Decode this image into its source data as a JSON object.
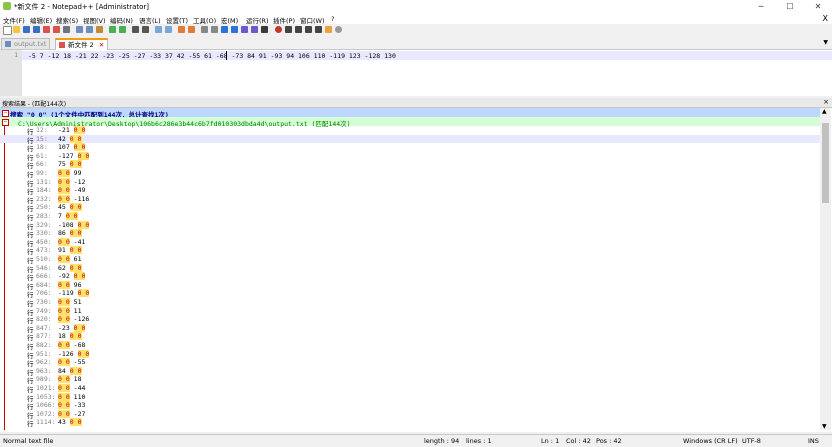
{
  "window": {
    "title": "*新文件 2 - Notepad++ [Administrator]",
    "minimize": "─",
    "maximize": "☐",
    "close": "✕"
  },
  "menu": {
    "items": [
      "文件(F)",
      "编辑(E)",
      "搜索(S)",
      "视图(V)",
      "编码(N)",
      "语言(L)",
      "设置(T)",
      "工具(O)",
      "宏(M)",
      "运行(R)",
      "插件(P)",
      "窗口(W)",
      "?"
    ],
    "close": "X"
  },
  "tabs": [
    {
      "label": "output.txt",
      "active": false
    },
    {
      "label": "新文件 2",
      "active": true
    }
  ],
  "tab_close": "✕",
  "tab_dropdown": "▼",
  "editor": {
    "line_number": "1",
    "text": "-5 7 -12 18 -21 22 -23 -25 -27 -33 37 42 -55 61 -68 -73 84 91 -93 94 106 110 -119 123 -128 130"
  },
  "find_panel": {
    "title": "搜索结果 - (匹配144次)",
    "close": "×",
    "search_line": "搜索 \"0 0\" (1个文件中匹配到144次，总计查找1次)",
    "file_line": "C:\\Users\\Administrator\\Desktop\\106b6c286e3b44c6b7fd010303dbda4d\\output.txt (匹配144次)",
    "row_prefix": "行",
    "rows": [
      {
        "line": "12",
        "before": "-21 ",
        "match": "0 0",
        "after": ""
      },
      {
        "line": "15",
        "before": "42 ",
        "match": "0 0",
        "after": ""
      },
      {
        "line": "18",
        "before": "107 ",
        "match": "0 0",
        "after": ""
      },
      {
        "line": "61",
        "before": "-127 ",
        "match": "0 0",
        "after": ""
      },
      {
        "line": "66",
        "before": "75 ",
        "match": "0 0",
        "after": ""
      },
      {
        "line": "99",
        "before": "",
        "match": "0 0",
        "after": " 99"
      },
      {
        "line": "131",
        "before": "",
        "match": "0 0",
        "after": " -12"
      },
      {
        "line": "184",
        "before": "",
        "match": "0 0",
        "after": " -49"
      },
      {
        "line": "232",
        "before": "",
        "match": "0 0",
        "after": " -116"
      },
      {
        "line": "250",
        "before": "45 ",
        "match": "0 0",
        "after": ""
      },
      {
        "line": "283",
        "before": "7 ",
        "match": "0 0",
        "after": ""
      },
      {
        "line": "329",
        "before": "-108 ",
        "match": "0 0",
        "after": ""
      },
      {
        "line": "330",
        "before": "86 ",
        "match": "0 0",
        "after": ""
      },
      {
        "line": "450",
        "before": "",
        "match": "0 0",
        "after": " -41"
      },
      {
        "line": "473",
        "before": "91 ",
        "match": "0 0",
        "after": ""
      },
      {
        "line": "510",
        "before": "",
        "match": "0 0",
        "after": " 61"
      },
      {
        "line": "546",
        "before": "62 ",
        "match": "0 0",
        "after": ""
      },
      {
        "line": "666",
        "before": "-92 ",
        "match": "0 0",
        "after": ""
      },
      {
        "line": "684",
        "before": "",
        "match": "0 0",
        "after": " 96"
      },
      {
        "line": "706",
        "before": "-119 ",
        "match": "0 0",
        "after": ""
      },
      {
        "line": "730",
        "before": "",
        "match": "0 0",
        "after": " 51"
      },
      {
        "line": "749",
        "before": "",
        "match": "0 0",
        "after": " 11"
      },
      {
        "line": "820",
        "before": "",
        "match": "0 0",
        "after": " -126"
      },
      {
        "line": "847",
        "before": "-23 ",
        "match": "0 0",
        "after": ""
      },
      {
        "line": "877",
        "before": "18 ",
        "match": "0 0",
        "after": ""
      },
      {
        "line": "882",
        "before": "",
        "match": "0 0",
        "after": " -68"
      },
      {
        "line": "951",
        "before": "-126 ",
        "match": "0 0",
        "after": ""
      },
      {
        "line": "962",
        "before": "",
        "match": "0 0",
        "after": " -55"
      },
      {
        "line": "963",
        "before": "84 ",
        "match": "0 0",
        "after": ""
      },
      {
        "line": "989",
        "before": "",
        "match": "0 0",
        "after": " 18"
      },
      {
        "line": "1021",
        "before": "",
        "match": "0 0",
        "after": " -44"
      },
      {
        "line": "1053",
        "before": "",
        "match": "0 0",
        "after": " 110"
      },
      {
        "line": "1066",
        "before": "",
        "match": "0 0",
        "after": " -33"
      },
      {
        "line": "1072",
        "before": "",
        "match": "0 0",
        "after": " -27"
      },
      {
        "line": "1114",
        "before": "43 ",
        "match": "0 0",
        "after": ""
      }
    ]
  },
  "status": {
    "file_type": "Normal text file",
    "length": "length : 94",
    "lines": "lines : 1",
    "ln": "Ln : 1",
    "col": "Col : 42",
    "pos": "Pos : 42",
    "eol": "Windows (CR LF)",
    "encoding": "UTF-8",
    "mode": "INS"
  },
  "colors": {
    "selected_line": "#e8e8ff",
    "search_header": "#bcd8ff",
    "file_header": "#d5ffd5",
    "match_highlight": "#ffe16b"
  }
}
